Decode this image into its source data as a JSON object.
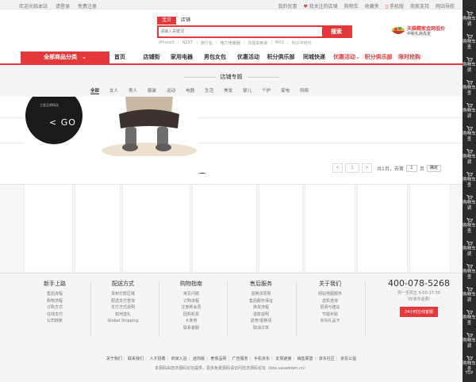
{
  "topbar": {
    "left": [
      "欢迎光临本站",
      "请登录",
      "免费注册"
    ],
    "right": [
      "我的优惠",
      "我关注的店铺",
      "购物车",
      "收藏夹",
      "手机版",
      "商家支持",
      "网站导航"
    ]
  },
  "search": {
    "tabs": [
      "宝贝",
      "店铺"
    ],
    "placeholder": "请输入关键词",
    "button": "搜索",
    "hotwords": [
      "iPhone5",
      "NZXT",
      "旅行包",
      "格力电暖器",
      "华强夹到家",
      "MX2",
      "叩小平时代"
    ]
  },
  "promo": {
    "line1": "天猫精家金网低价",
    "line2": "中秋礼尚先定"
  },
  "nav": {
    "category": "全部商品分类",
    "items": [
      "首页",
      "店铺街",
      "家用电器",
      "男包女包",
      "优惠活动",
      "积分俱乐部",
      "同城快递",
      "优惠活动",
      "积分俱乐部",
      "限时抢购"
    ]
  },
  "section": {
    "title": "店铺专题",
    "filters": [
      "全部",
      "女人",
      "男人",
      "服装",
      "运动",
      "电器",
      "生活",
      "美妆",
      "婴儿",
      "个护",
      "家电",
      "网络"
    ]
  },
  "banner": {
    "go_text": "< GO",
    "small_text": "主要品牌精选"
  },
  "pager": {
    "prev": "<",
    "page": "1",
    "next": ">",
    "total": "共1页，去第",
    "input": "1",
    "unit": "页",
    "confirm": "确定"
  },
  "footer": {
    "columns": [
      {
        "title": "新手上路",
        "links": [
          "售后流程",
          "购物流程",
          "订购方式",
          "在线支付",
          "公司转账"
        ]
      },
      {
        "title": "配送方式",
        "links": [
          "货到付款区域",
          "配送支付查询",
          "支付方式说明",
          "如何送礼",
          "Global Shipping"
        ]
      },
      {
        "title": "购物指南",
        "links": [
          "常见问题",
          "订购流程",
          "注册新会员",
          "团购机票",
          "大家电",
          "联系客服"
        ]
      },
      {
        "title": "售后服务",
        "links": [
          "退换货原则",
          "售后服务保证",
          "换货流程",
          "退款说明",
          "返修/退换货",
          "取消订单"
        ]
      },
      {
        "title": "关于我们",
        "links": [
          "网站地图服务",
          "选机咨询",
          "招贤与建议",
          "节能补贴",
          "京东礼品卡"
        ]
      }
    ],
    "hotline": "400-078-5268",
    "hours": "周一至周五 9:00-17:30",
    "note": "（仅收市话费）",
    "service_button": "24小时在线客服",
    "links": [
      "关于我们",
      "联系我们",
      "人才招聘",
      "商家入驻",
      "迷你版",
      "奢侈品网",
      "广告服务",
      "手机京东",
      "友情链接",
      "销售联盟",
      "京东社区",
      "京东公益"
    ],
    "copyright": "本源码由您济源码论坛提供，更多免费源码请访问您济源码论坛（bbs.sasadown.cn）"
  },
  "sidebar": {
    "items": [
      "购物车",
      "购物车",
      "购物车",
      "购物车",
      "购物车",
      "购物车",
      "购物车",
      "购物车",
      "购物车",
      "购物车",
      "购物车",
      "购物车",
      "购物车",
      "购物车",
      "购物车",
      "购物车"
    ],
    "subs": [
      "调",
      "查",
      "调",
      "查",
      "调",
      "查",
      "调",
      "查",
      "调",
      "查",
      "调",
      "查",
      "调",
      "查",
      "调",
      "查"
    ],
    "top": "TOP"
  },
  "colors": {
    "accent": "#e4393c",
    "sidebar": "#2b2b2b",
    "footer_bg": "#f5f5f5"
  }
}
